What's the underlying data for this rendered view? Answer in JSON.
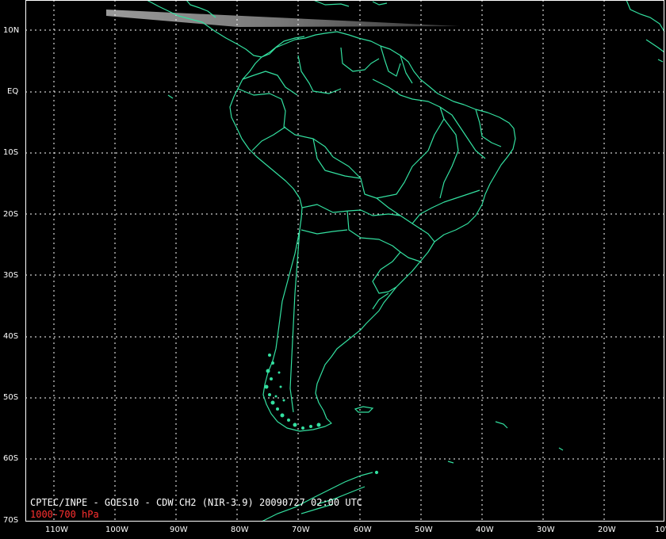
{
  "map": {
    "caption": "CPTEC/INPE - GOES10 - CDW CH2 (NIR-3.9) 20090727 02:00 UTC",
    "level_label": "1000-700 hPa",
    "lat_ticks": [
      "10N",
      "EQ",
      "10S",
      "20S",
      "30S",
      "40S",
      "50S",
      "60S",
      "70S"
    ],
    "lon_ticks": [
      "110W",
      "100W",
      "90W",
      "80W",
      "70W",
      "60W",
      "50W",
      "40W",
      "30W",
      "20W",
      "10W"
    ],
    "colors": {
      "background": "#000000",
      "coastline": "#33e0a0",
      "grid": "#ffffff",
      "level_text": "#ff3030",
      "label_text": "#ffffff"
    }
  }
}
